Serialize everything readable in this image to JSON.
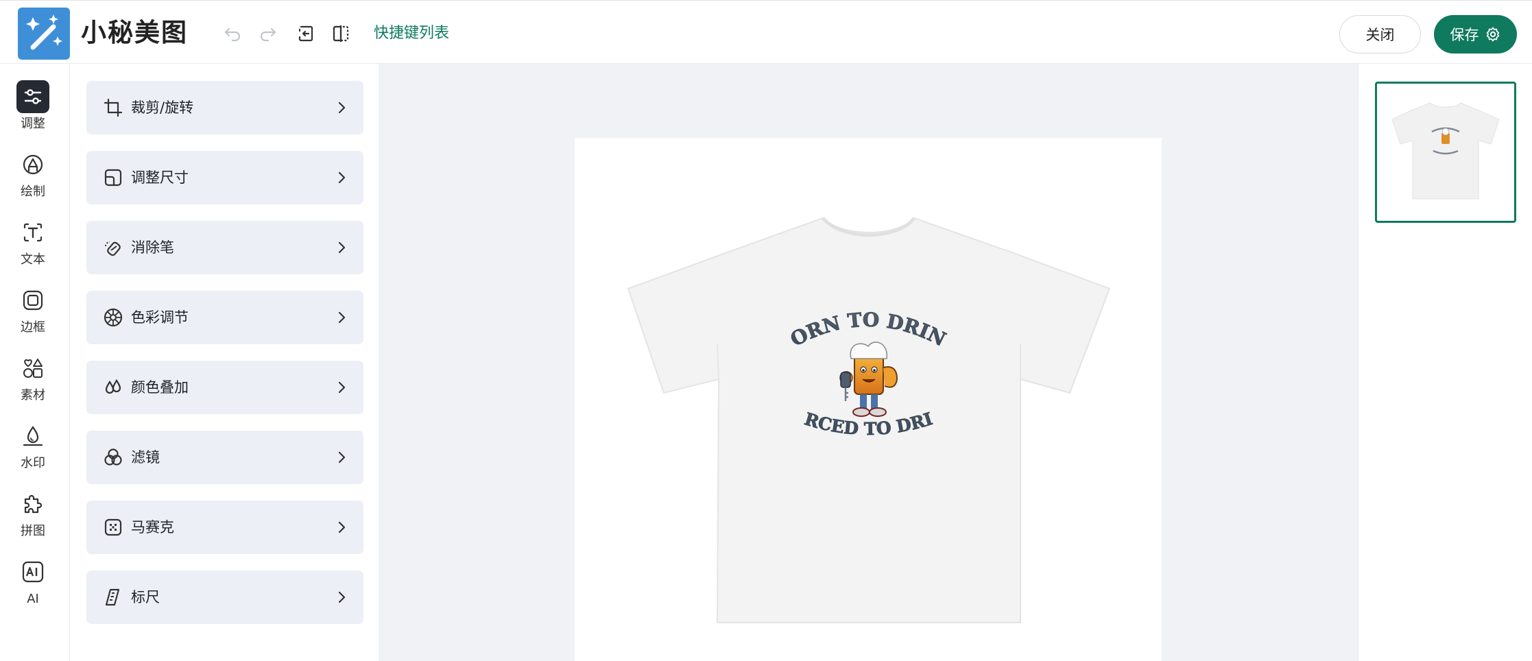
{
  "header": {
    "app_title": "小秘美图",
    "shortcut_link": "快捷键列表",
    "close_label": "关闭",
    "save_label": "保存"
  },
  "nav": {
    "items": [
      {
        "label": "调整",
        "icon": "sliders-icon",
        "active": true
      },
      {
        "label": "绘制",
        "icon": "draw-icon"
      },
      {
        "label": "文本",
        "icon": "text-icon"
      },
      {
        "label": "边框",
        "icon": "border-icon"
      },
      {
        "label": "素材",
        "icon": "shapes-icon"
      },
      {
        "label": "水印",
        "icon": "watermark-icon"
      },
      {
        "label": "拼图",
        "icon": "puzzle-icon"
      },
      {
        "label": "AI",
        "icon": "ai-icon"
      }
    ]
  },
  "tools": {
    "items": [
      {
        "label": "裁剪/旋转",
        "icon": "crop-icon"
      },
      {
        "label": "调整尺寸",
        "icon": "resize-icon"
      },
      {
        "label": "消除笔",
        "icon": "eraser-icon"
      },
      {
        "label": "色彩调节",
        "icon": "color-wheel-icon"
      },
      {
        "label": "颜色叠加",
        "icon": "droplets-icon"
      },
      {
        "label": "滤镜",
        "icon": "filter-icon"
      },
      {
        "label": "马赛克",
        "icon": "mosaic-icon"
      },
      {
        "label": "标尺",
        "icon": "ruler-icon"
      }
    ]
  },
  "canvas": {
    "shirt_text_top": "BORN TO DRINK",
    "shirt_text_bottom": "FORCED TO DRIVE"
  },
  "colors": {
    "accent": "#0f7a5e",
    "logo_bg": "#3f8fd8",
    "canvas_bg": "#f0f2f6",
    "tool_bg": "#eceff5"
  }
}
